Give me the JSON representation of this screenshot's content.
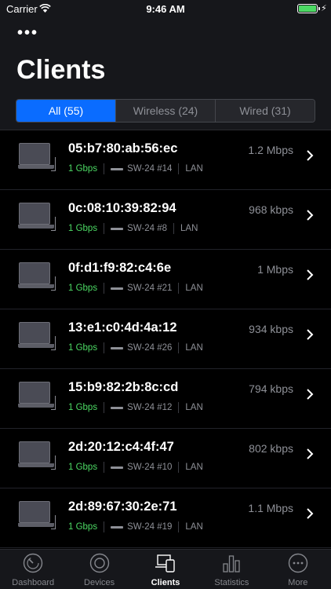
{
  "status_bar": {
    "carrier": "Carrier",
    "time": "9:46 AM"
  },
  "header": {
    "title": "Clients"
  },
  "segments": [
    {
      "label": "All (55)"
    },
    {
      "label": "Wireless (24)"
    },
    {
      "label": "Wired (31)"
    }
  ],
  "clients": [
    {
      "mac": "05:b7:80:ab:56:ec",
      "rate": "1.2 Mbps",
      "speed": "1 Gbps",
      "port": "SW-24 #14",
      "network": "LAN"
    },
    {
      "mac": "0c:08:10:39:82:94",
      "rate": "968 kbps",
      "speed": "1 Gbps",
      "port": "SW-24 #8",
      "network": "LAN"
    },
    {
      "mac": "0f:d1:f9:82:c4:6e",
      "rate": "1 Mbps",
      "speed": "1 Gbps",
      "port": "SW-24 #21",
      "network": "LAN"
    },
    {
      "mac": "13:e1:c0:4d:4a:12",
      "rate": "934 kbps",
      "speed": "1 Gbps",
      "port": "SW-24 #26",
      "network": "LAN"
    },
    {
      "mac": "15:b9:82:2b:8c:cd",
      "rate": "794 kbps",
      "speed": "1 Gbps",
      "port": "SW-24 #12",
      "network": "LAN"
    },
    {
      "mac": "2d:20:12:c4:4f:47",
      "rate": "802 kbps",
      "speed": "1 Gbps",
      "port": "SW-24 #10",
      "network": "LAN"
    },
    {
      "mac": "2d:89:67:30:2e:71",
      "rate": "1.1 Mbps",
      "speed": "1 Gbps",
      "port": "SW-24 #19",
      "network": "LAN"
    }
  ],
  "tabs": [
    {
      "label": "Dashboard"
    },
    {
      "label": "Devices"
    },
    {
      "label": "Clients"
    },
    {
      "label": "Statistics"
    },
    {
      "label": "More"
    }
  ],
  "colors": {
    "accent": "#0a6cff",
    "speed": "#4cd964",
    "background": "#000000",
    "bar": "#16171b"
  }
}
